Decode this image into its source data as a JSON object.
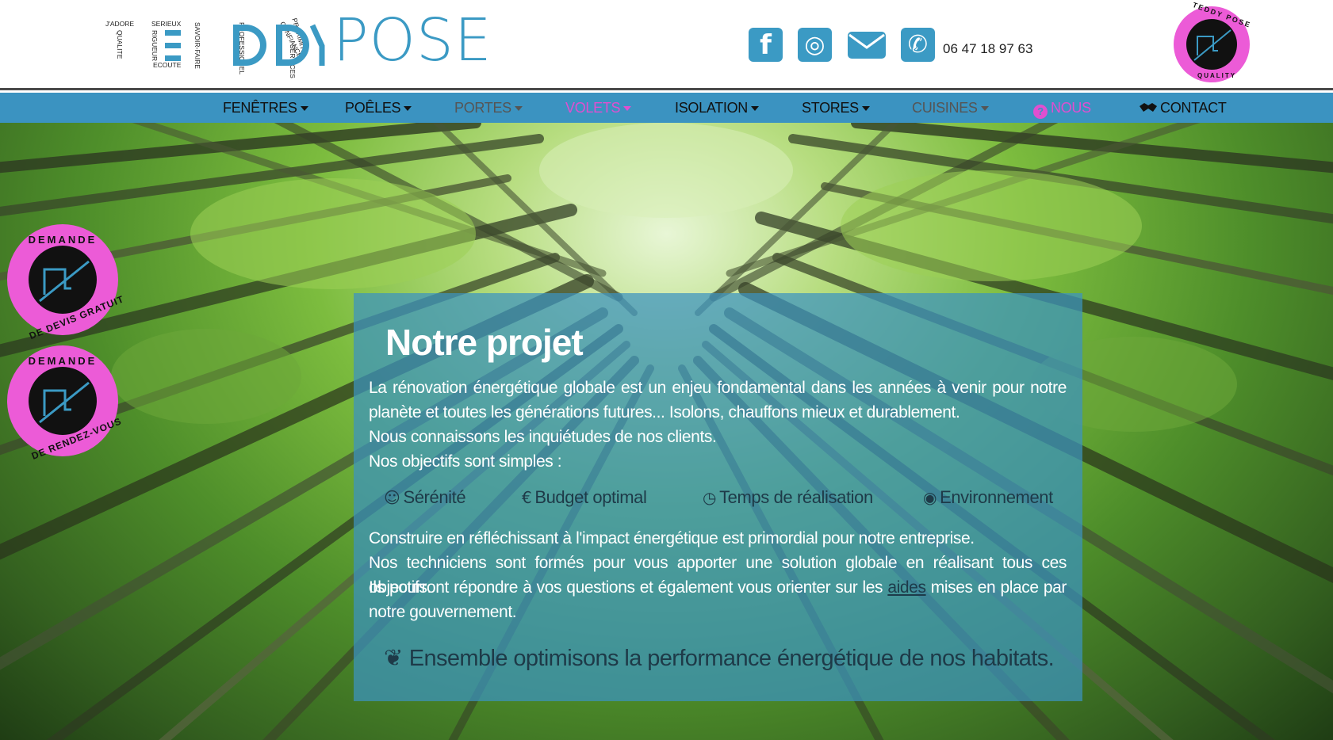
{
  "brand": {
    "name": "TEDDY POSE",
    "name_part_tail": "POSE",
    "tagline_words": [
      "J'ADORE",
      "QUALITE",
      "SERIEUX",
      "RIGUEUR",
      "ECOUTE",
      "SAVOIR-FAIRE",
      "PROFESSIONEL",
      "CONFIANCE",
      "PROXIMITE",
      "SERVICES"
    ],
    "brand_color": "#3b9ac4",
    "accent_color": "#ec5bd7"
  },
  "header": {
    "phone": "06 47 18 97 63",
    "social": [
      {
        "icon": "facebook-icon",
        "glyph": "f"
      },
      {
        "icon": "instagram-icon",
        "glyph": "◎"
      },
      {
        "icon": "envelope-icon",
        "glyph": "✉"
      },
      {
        "icon": "phone-icon",
        "glyph": "✆"
      }
    ],
    "badge": {
      "top": "TEDDY POSE",
      "bottom": "QUALITY"
    }
  },
  "nav": {
    "items": [
      {
        "label": "FENÊTRES",
        "style": "dark",
        "caret": true
      },
      {
        "label": "POÊLES",
        "style": "dark",
        "caret": true
      },
      {
        "label": "PORTES",
        "style": "grey",
        "caret": true
      },
      {
        "label": "VOLETS",
        "style": "pink",
        "caret": true
      },
      {
        "label": "ISOLATION",
        "style": "dark",
        "caret": true
      },
      {
        "label": "STORES",
        "style": "dark",
        "caret": true
      },
      {
        "label": "CUISINES",
        "style": "grey",
        "caret": true
      },
      {
        "label": "NOUS",
        "style": "pink",
        "caret": false,
        "icon": "question-circle-icon"
      },
      {
        "label": "CONTACT",
        "style": "dark",
        "caret": false,
        "icon": "handshake-icon"
      }
    ]
  },
  "side_badges": [
    {
      "top": "DEMANDE",
      "bottom": "DE DEVIS GRATUIT"
    },
    {
      "top": "DEMANDE",
      "bottom": "DE RENDEZ-VOUS"
    }
  ],
  "content": {
    "title": "Notre projet",
    "intro_1": "La rénovation énergétique globale est un enjeu fondamental dans les années à venir pour notre planète et toutes les générations futures... Isolons, chauffons mieux et durablement.",
    "intro_2": "Nous connaissons les inquiétudes de nos clients.",
    "intro_3": "Nos objectifs sont simples :",
    "goals": [
      {
        "icon": "smile-icon",
        "glyph": "☺",
        "label": "Sérénité"
      },
      {
        "icon": "euro-icon",
        "glyph": "€",
        "label": "Budget optimal"
      },
      {
        "icon": "clock-icon",
        "glyph": "◷",
        "label": "Temps de réalisation"
      },
      {
        "icon": "globe-icon",
        "glyph": "◉",
        "label": "Environnement"
      }
    ],
    "body_1": "Construire en réfléchissant à l'impact énergétique est primordial pour notre entreprise.",
    "body_2": "Nos techniciens sont formés pour vous apporter une solution globale en réalisant tous ces objectifs.",
    "body_3_before": "Ils pourront répondre à vos questions et également vous orienter sur les ",
    "body_3_link": "aides",
    "body_3_after": " mises en place par notre gouvernement.",
    "slogan_glyph": "❦",
    "slogan": "Ensemble optimisons la performance énergétique de nos habitats."
  }
}
